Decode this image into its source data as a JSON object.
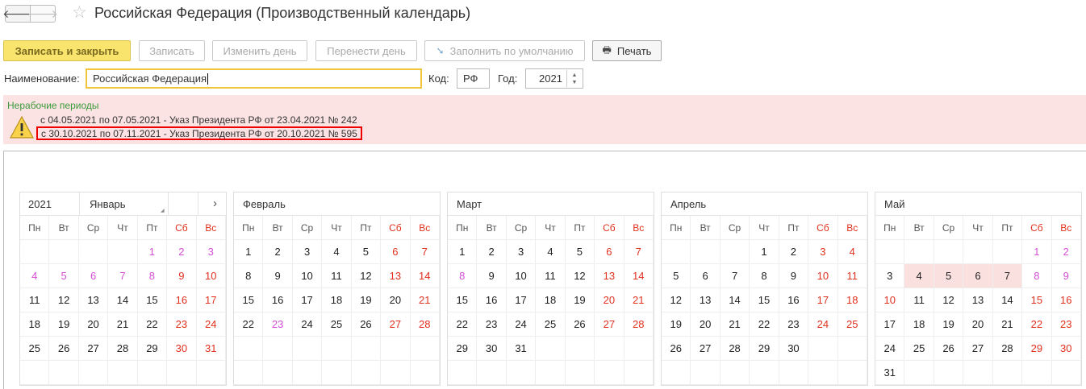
{
  "window": {
    "back_glyph": "🡐",
    "forward_glyph": "🡒",
    "title": "Российская Федерация (Производственный календарь)"
  },
  "toolbar": {
    "save_close": "Записать и закрыть",
    "save": "Записать",
    "change_day": "Изменить день",
    "move_day": "Перенести день",
    "fill_default": "Заполнить по умолчанию",
    "print": "Печать"
  },
  "form": {
    "name_label": "Наименование:",
    "name_value": "Российская Федерация",
    "code_label": "Код:",
    "code_value": "РФ",
    "year_label": "Год:",
    "year_value": "2021"
  },
  "alert": {
    "title": "Нерабочие периоды",
    "lines": [
      "с 04.05.2021 по 07.05.2021 - Указ Президента РФ от 23.04.2021 № 242",
      "с 30.10.2021 по 07.11.2021 - Указ Президента РФ от 20.10.2021 № 595"
    ]
  },
  "calendar": {
    "year": "2021",
    "weekdays": [
      "Пн",
      "Вт",
      "Ср",
      "Чт",
      "Пт",
      "Сб",
      "Вс"
    ],
    "next_arrow": "›",
    "months": [
      {
        "name": "Январь",
        "offset": 4,
        "days": 31,
        "others": [
          1,
          2,
          3,
          4,
          5,
          6,
          7,
          8
        ],
        "holidays": [
          9,
          10,
          16,
          17,
          23,
          24,
          30,
          31
        ],
        "shaded": []
      },
      {
        "name": "Февраль",
        "offset": 0,
        "days": 28,
        "others": [
          23
        ],
        "holidays": [
          6,
          7,
          13,
          14,
          21,
          27,
          28
        ],
        "shaded": []
      },
      {
        "name": "Март",
        "offset": 0,
        "days": 31,
        "others": [
          8
        ],
        "holidays": [
          6,
          7,
          13,
          14,
          20,
          21,
          27,
          28
        ],
        "shaded": []
      },
      {
        "name": "Апрель",
        "offset": 3,
        "days": 30,
        "others": [],
        "holidays": [
          3,
          4,
          10,
          11,
          17,
          18,
          24,
          25
        ],
        "shaded": []
      },
      {
        "name": "Май",
        "offset": 5,
        "days": 31,
        "others": [
          1,
          2,
          8,
          9
        ],
        "holidays": [
          10,
          15,
          16,
          22,
          23,
          29,
          30
        ],
        "shaded": [
          4,
          5,
          6,
          7
        ]
      }
    ]
  },
  "colors": {
    "primary_button": "#f9e56e",
    "holiday": "#e0301e",
    "transferred_holiday": "#d54ed5",
    "alert_bg": "#fce3e3",
    "alert_title": "#3b9a3b",
    "highlight_border": "#ee0000"
  }
}
